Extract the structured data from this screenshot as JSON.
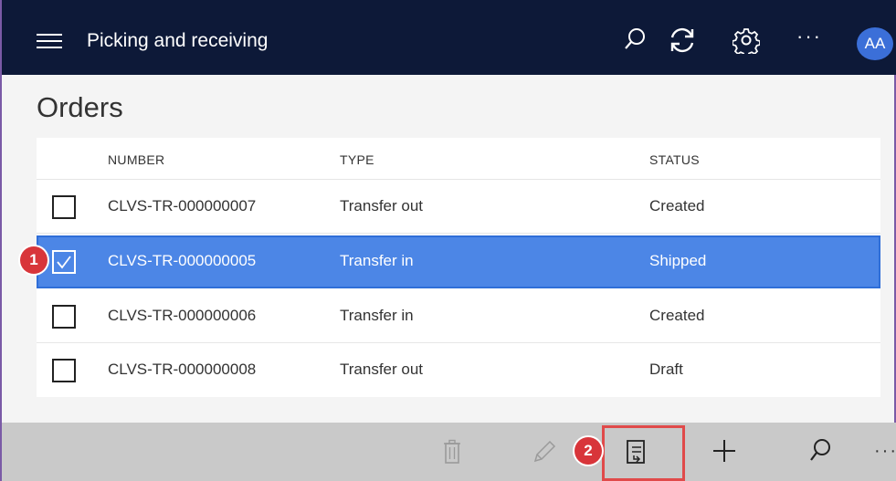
{
  "header": {
    "app_title": "Picking and receiving",
    "menu_icon": "hamburger-menu-icon",
    "search_icon": "search-icon",
    "refresh_icon": "refresh-icon",
    "settings_icon": "gear-icon",
    "more_label": "···",
    "avatar_initials": "AA"
  },
  "page": {
    "title": "Orders"
  },
  "table": {
    "columns": [
      "NUMBER",
      "TYPE",
      "STATUS"
    ],
    "rows": [
      {
        "number": "CLVS-TR-000000007",
        "type": "Transfer out",
        "status": "Created",
        "checked": false
      },
      {
        "number": "CLVS-TR-000000005",
        "type": "Transfer in",
        "status": "Shipped",
        "checked": true
      },
      {
        "number": "CLVS-TR-000000006",
        "type": "Transfer in",
        "status": "Created",
        "checked": false
      },
      {
        "number": "CLVS-TR-000000008",
        "type": "Transfer out",
        "status": "Draft",
        "checked": false
      }
    ]
  },
  "callouts": {
    "one": "1",
    "two": "2"
  },
  "actionbar": {
    "delete_icon": "trash-icon",
    "edit_icon": "pencil-icon",
    "receive_icon": "document-receive-icon",
    "add_icon": "plus-icon",
    "search_icon": "search-icon",
    "more_label": "···"
  },
  "colors": {
    "topbar": "#0d1938",
    "selected_row": "#4c86e6",
    "avatar": "#3b6fd8",
    "callout": "#d8353a",
    "highlight": "#e04a4a",
    "actionbar": "#c9c9c9"
  }
}
